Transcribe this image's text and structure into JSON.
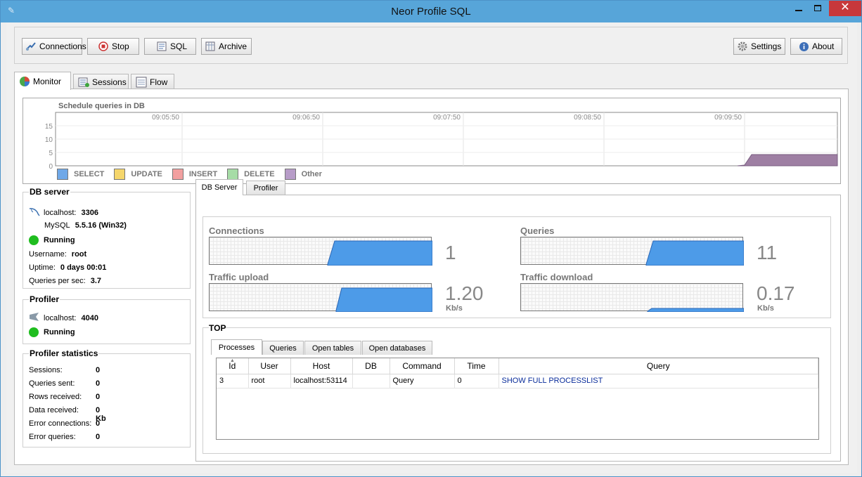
{
  "window": {
    "title": "Neor Profile SQL",
    "close_glyph": "✕"
  },
  "toolbar": {
    "connections": "Connections",
    "stop": "Stop",
    "sql": "SQL",
    "archive": "Archive",
    "settings": "Settings",
    "about": "About"
  },
  "main_tabs": [
    "Monitor",
    "Sessions",
    "Flow"
  ],
  "schedule_chart": {
    "title": "Schedule queries in DB",
    "time_labels": [
      "09:05:50",
      "09:06:50",
      "09:07:50",
      "09:08:50",
      "09:09:50"
    ],
    "y_ticks": [
      "15",
      "10",
      "5",
      "0"
    ],
    "legend": [
      {
        "label": "SELECT",
        "color": "#6fa8e8"
      },
      {
        "label": "UPDATE",
        "color": "#f5d66c"
      },
      {
        "label": "INSERT",
        "color": "#f2a0a0"
      },
      {
        "label": "DELETE",
        "color": "#a6dca6"
      },
      {
        "label": "Other",
        "color": "#b79cc8"
      }
    ],
    "other_fill": "#9e7fa3"
  },
  "db_server": {
    "title": "DB server",
    "host": "localhost:",
    "port": "3306",
    "mysql_label": "MySQL",
    "mysql_version": "5.5.16 (Win32)",
    "status": "Running",
    "username_label": "Username:",
    "username": "root",
    "uptime_label": "Uptime:",
    "uptime": "0 days 00:01",
    "qps_label": "Queries per sec:",
    "qps": "3.7"
  },
  "profiler": {
    "title": "Profiler",
    "host": "localhost:",
    "port": "4040",
    "status": "Running"
  },
  "profiler_stats": {
    "title": "Profiler statistics",
    "rows": [
      {
        "label": "Sessions:",
        "value": "0"
      },
      {
        "label": "Queries sent:",
        "value": "0"
      },
      {
        "label": "Rows received:",
        "value": "0"
      },
      {
        "label": "Data received:",
        "value": "0 Kb"
      },
      {
        "label": "Error connections:",
        "value": "0"
      },
      {
        "label": "Error queries:",
        "value": "0"
      }
    ]
  },
  "sub_tabs": [
    "DB Server",
    "Profiler"
  ],
  "metrics": {
    "connections": {
      "label": "Connections",
      "value": "1"
    },
    "queries": {
      "label": "Queries",
      "value": "11"
    },
    "traffic_upload": {
      "label": "Traffic upload",
      "value": "1.20",
      "unit": "Kb/s"
    },
    "traffic_download": {
      "label": "Traffic download",
      "value": "0.17",
      "unit": "Kb/s"
    },
    "fill_color": "#4d9be8"
  },
  "top": {
    "title": "TOP",
    "tabs": [
      "Processes",
      "Queries",
      "Open tables",
      "Open databases"
    ],
    "columns": [
      "Id",
      "User",
      "Host",
      "DB",
      "Command",
      "Time",
      "Query"
    ],
    "rows": [
      [
        "3",
        "root",
        "localhost:53114",
        "",
        "Query",
        "0",
        "SHOW FULL PROCESSLIST"
      ]
    ]
  }
}
